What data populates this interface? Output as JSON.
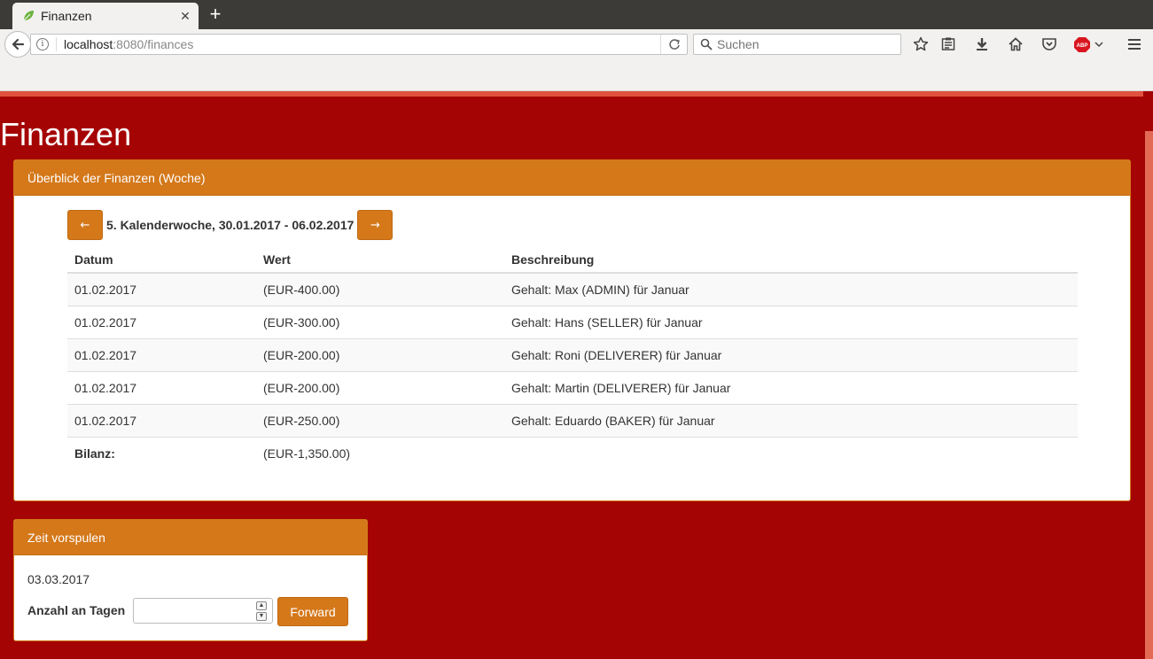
{
  "browser": {
    "tab_title": "Finanzen",
    "tab_close": "✕",
    "new_tab": "+",
    "url_host": "localhost",
    "url_path": ":8080/finances",
    "search_placeholder": "Suchen",
    "icons": [
      "back-icon",
      "info-icon",
      "reload-icon",
      "search-icon",
      "bookmark-star-icon",
      "reader-list-icon",
      "download-icon",
      "home-icon",
      "pocket-icon",
      "adblock-icon",
      "menu-icon"
    ]
  },
  "page": {
    "title": "Finanzen"
  },
  "overview": {
    "heading": "Überblick der Finanzen (Woche)",
    "prev_label": "←",
    "next_label": "→",
    "week_label": "5. Kalenderwoche, 30.01.2017 - 06.02.2017",
    "columns": [
      "Datum",
      "Wert",
      "Beschreibung"
    ],
    "rows": [
      {
        "datum": "01.02.2017",
        "wert": "(EUR-400.00)",
        "beschreibung": "Gehalt: Max (ADMIN) für Januar"
      },
      {
        "datum": "01.02.2017",
        "wert": "(EUR-300.00)",
        "beschreibung": "Gehalt: Hans (SELLER) für Januar"
      },
      {
        "datum": "01.02.2017",
        "wert": "(EUR-200.00)",
        "beschreibung": "Gehalt: Roni (DELIVERER) für Januar"
      },
      {
        "datum": "01.02.2017",
        "wert": "(EUR-200.00)",
        "beschreibung": "Gehalt: Martin (DELIVERER) für Januar"
      },
      {
        "datum": "01.02.2017",
        "wert": "(EUR-250.00)",
        "beschreibung": "Gehalt: Eduardo (BAKER) für Januar"
      }
    ],
    "bilanz_label": "Bilanz:",
    "bilanz_value": "(EUR-1,350.00)"
  },
  "time_forward": {
    "heading": "Zeit vorspulen",
    "current_date": "03.03.2017",
    "days_label": "Anzahl an Tagen",
    "days_value": "",
    "forward_label": "Forward"
  },
  "colors": {
    "page_background": "#a50404",
    "panel_accent": "#d4781a",
    "top_stripe": "#e0523e"
  }
}
